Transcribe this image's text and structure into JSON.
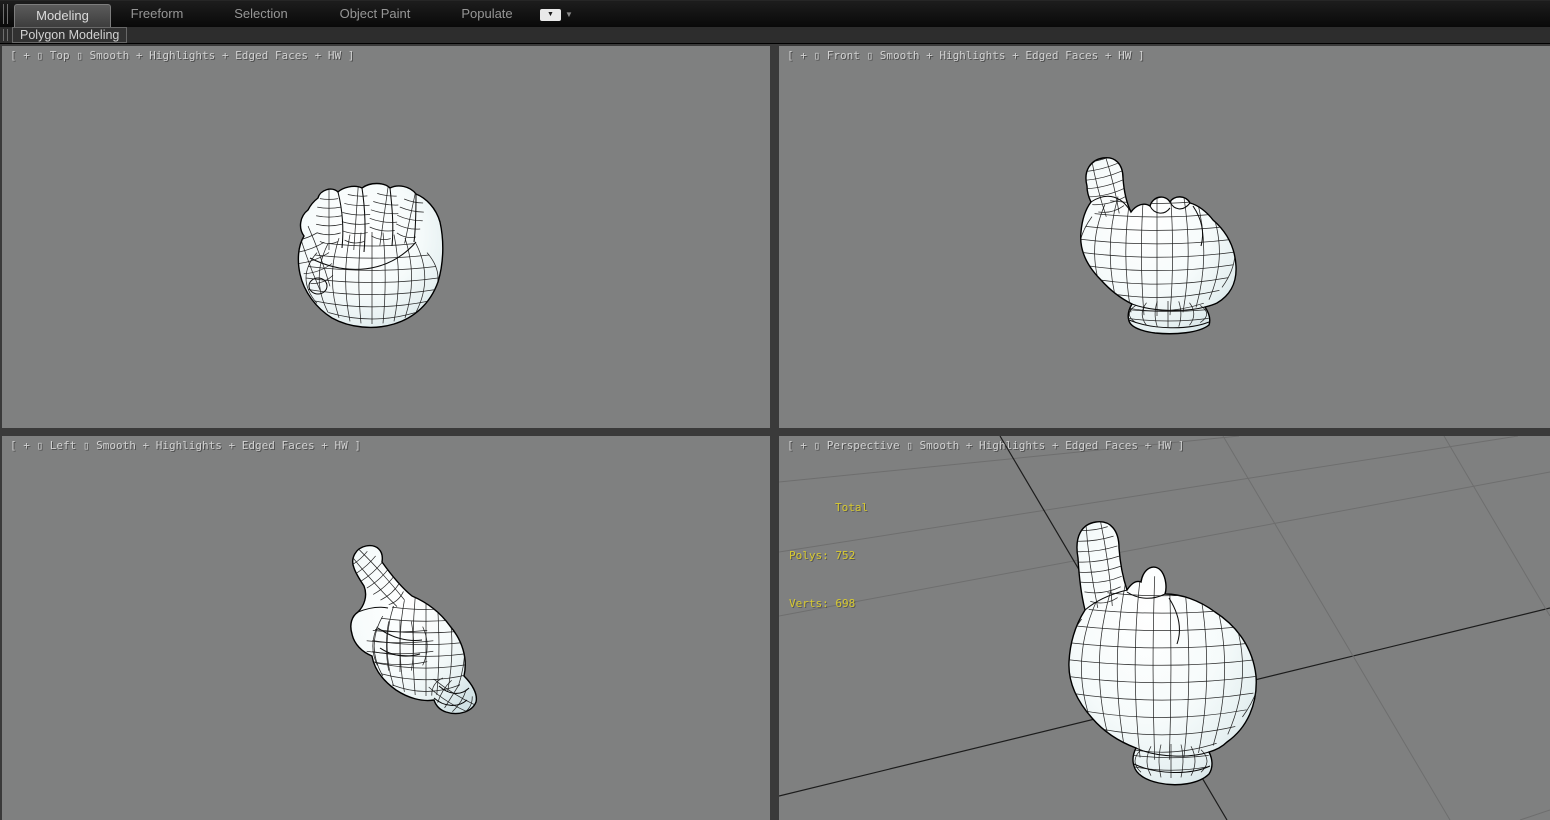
{
  "ribbon": {
    "tabs": [
      {
        "label": "Modeling",
        "active": true
      },
      {
        "label": "Freeform",
        "active": false
      },
      {
        "label": "Selection",
        "active": false
      },
      {
        "label": "Object Paint",
        "active": false
      },
      {
        "label": "Populate",
        "active": false
      }
    ],
    "collapse_icon": "ribbon-collapse-chevron",
    "panel_tab": "Polygon Modeling"
  },
  "viewports": {
    "top": {
      "label": "[ + ▯ Top ▯ Smooth + Highlights + Edged Faces + HW ]"
    },
    "front": {
      "label": "[ + ▯ Front ▯ Smooth + Highlights + Edged Faces + HW ]"
    },
    "left": {
      "label": "[ + ▯ Left ▯ Smooth + Highlights + Edged Faces + HW ]"
    },
    "perspective": {
      "label": "[ + ▯ Perspective ▯ Smooth + Highlights + Edged Faces + HW ]",
      "statistics": {
        "total_label": "Total",
        "polys_label": "Polys:",
        "polys_value": "752",
        "verts_label": "Verts:",
        "verts_value": "698"
      }
    }
  },
  "scene": {
    "object": "cartoon glove hand, index finger pointing up"
  },
  "colors": {
    "viewport_bg": "#7f8080",
    "stats_yellow": "#d8ca2f",
    "separator": "#3a3a3a",
    "ribbon_bg": "#0d0d0d",
    "grid_light": "#6e6e6e",
    "grid_dark": "#1c1c1c"
  }
}
